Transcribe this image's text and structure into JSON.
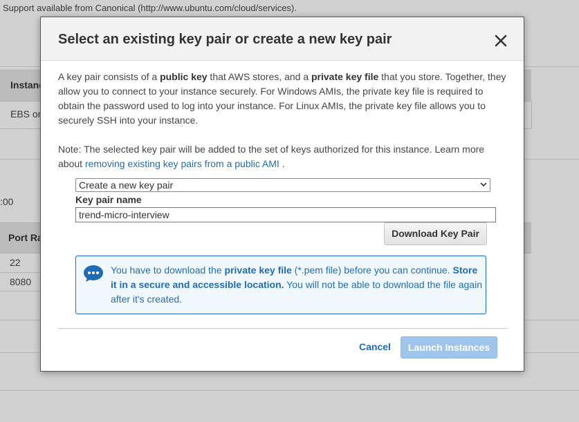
{
  "background": {
    "support_text": "Support available from Canonical (http://www.ubuntu.com/cloud/services).",
    "table1_header": "Instance",
    "table1_cell": "EBS only",
    "time_fragment": ":00",
    "table2_header": "Port Range",
    "ports": [
      "22",
      "8080"
    ]
  },
  "modal": {
    "title": "Select an existing key pair or create a new key pair",
    "close_icon": "close-icon",
    "desc": {
      "p1": "A key pair consists of a ",
      "b1": "public key",
      "p2": " that AWS stores, and a ",
      "b2": "private key file",
      "p3": " that you store. Together, they allow you to connect to your instance securely. For Windows AMIs, the private key file is required to obtain the password used to log into your instance. For Linux AMIs, the private key file allows you to securely SSH into your instance."
    },
    "note": {
      "text": "Note: The selected key pair will be added to the set of keys authorized for this instance. Learn more about ",
      "link": "removing existing key pairs from a public AMI",
      "end": " ."
    },
    "select": {
      "value": "Create a new key pair"
    },
    "key_pair_label": "Key pair name",
    "key_pair_value": "trend-micro-interview",
    "download_button": "Download Key Pair",
    "info": {
      "icon": "chat-bubble-icon",
      "t1": "You have to download the ",
      "b1": "private key file",
      "t2": " (*.pem file) before you can continue. ",
      "b2": "Store it in a secure and accessible location.",
      "t3": " You will not be able to download the file again after it's created."
    },
    "cancel_button": "Cancel",
    "launch_button": "Launch Instances"
  },
  "colors": {
    "accent": "#1f6cb4",
    "launch_disabled": "#9fc6ea",
    "info_bg": "#f1f8fd",
    "header_bg": "#f2f2f2"
  }
}
